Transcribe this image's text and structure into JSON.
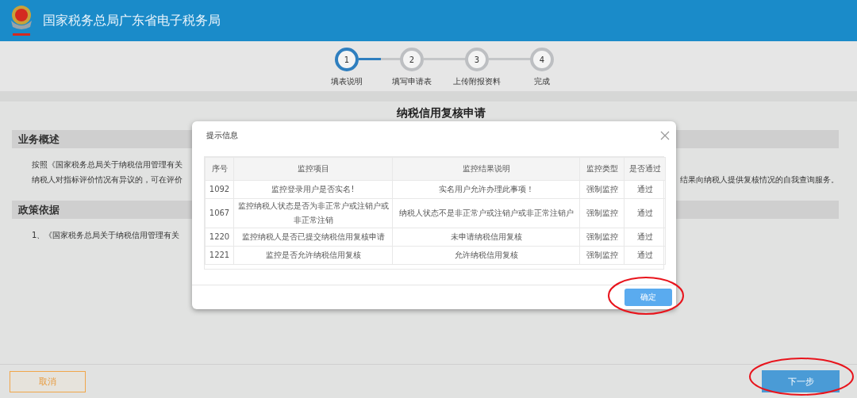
{
  "header": {
    "title": "国家税务总局广东省电子税务局"
  },
  "steps": [
    {
      "number": "1",
      "label": "填表说明",
      "selected": true
    },
    {
      "number": "2",
      "label": "填写申请表",
      "selected": false
    },
    {
      "number": "3",
      "label": "上传附报资料",
      "selected": false
    },
    {
      "number": "4",
      "label": "完成",
      "selected": false
    }
  ],
  "page_title": "纳税信用复核申请",
  "sections": [
    {
      "heading": "业务概述",
      "lines": [
        {
          "left": "按照《国家税务总局关于纳税信用管理有关"
        },
        {
          "left": "纳税人对指标评价情况有异议的，可在评价",
          "right": "结果向纳税人提供复核情况的自我查询服务。"
        }
      ]
    },
    {
      "heading": "政策依据",
      "lines": [
        {
          "left": "1、《国家税务总局关于纳税信用管理有关"
        }
      ]
    }
  ],
  "dialog": {
    "title": "提示信息",
    "table": {
      "columns": [
        "序号",
        "监控项目",
        "监控结果说明",
        "监控类型",
        "是否通过"
      ],
      "rows": [
        [
          "1092",
          "监控登录用户是否实名!",
          "实名用户允许办理此事项！",
          "强制监控",
          "通过"
        ],
        [
          "1067",
          "监控纳税人状态是否为非正常户或注销户或非正常注销",
          "纳税人状态不是非正常户或注销户或非正常注销户",
          "强制监控",
          "通过"
        ],
        [
          "1220",
          "监控纳税人是否已提交纳税信用复核申请",
          "未申请纳税信用复核",
          "强制监控",
          "通过"
        ],
        [
          "1221",
          "监控是否允许纳税信用复核",
          "允许纳税信用复核",
          "强制监控",
          "通过"
        ]
      ]
    },
    "confirm_button": "确定"
  },
  "footer": {
    "cancel_button": "取消",
    "next_button": "下一步"
  }
}
